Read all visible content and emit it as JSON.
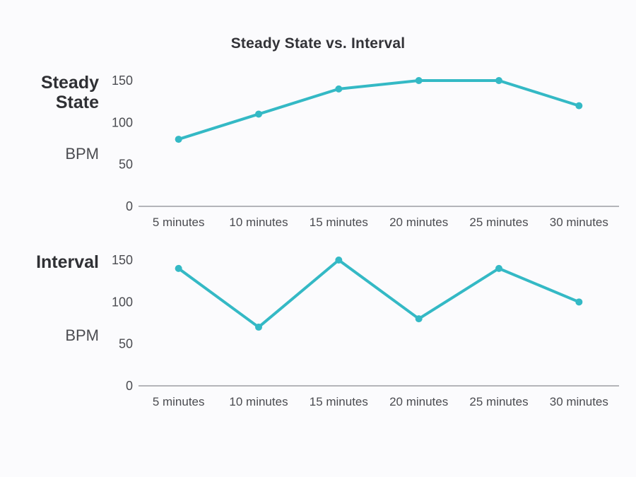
{
  "title": "Steady State vs. Interval",
  "ylabel": "BPM",
  "panels": {
    "steady": {
      "title_line1": "Steady",
      "title_line2": "State"
    },
    "interval": {
      "title": "Interval"
    }
  },
  "chart_data": [
    {
      "type": "line",
      "name": "Steady State",
      "categories": [
        "5 minutes",
        "10 minutes",
        "15 minutes",
        "20 minutes",
        "25 minutes",
        "30 minutes"
      ],
      "values": [
        80,
        110,
        140,
        150,
        150,
        120
      ],
      "ylabel": "BPM",
      "ylim": [
        0,
        150
      ],
      "yticks": [
        0,
        50,
        100,
        150
      ],
      "xlabel": "",
      "color": "#34b9c5"
    },
    {
      "type": "line",
      "name": "Interval",
      "categories": [
        "5 minutes",
        "10 minutes",
        "15 minutes",
        "20 minutes",
        "25 minutes",
        "30 minutes"
      ],
      "values": [
        140,
        70,
        150,
        80,
        140,
        100
      ],
      "ylabel": "BPM",
      "ylim": [
        0,
        150
      ],
      "yticks": [
        0,
        50,
        100,
        150
      ],
      "xlabel": "",
      "color": "#34b9c5"
    }
  ]
}
